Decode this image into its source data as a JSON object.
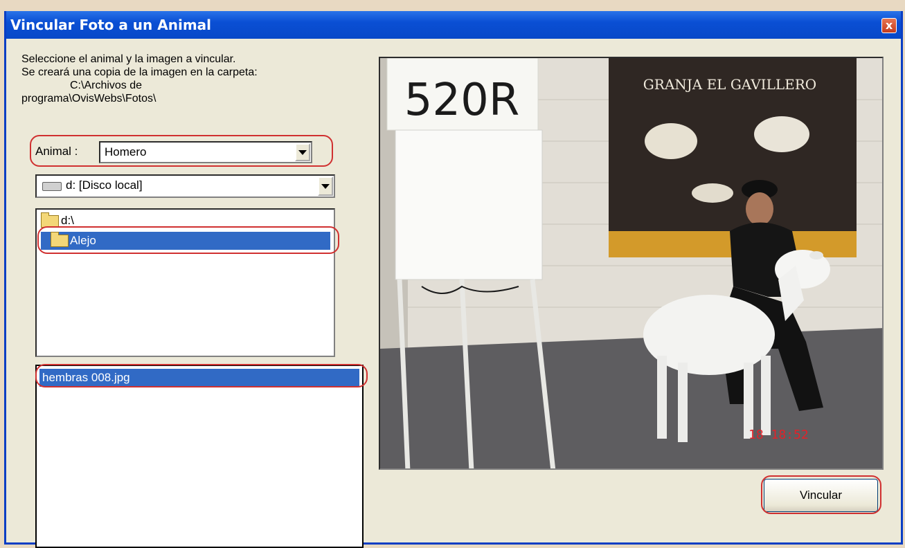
{
  "window": {
    "title": "Vincular Foto a un Animal",
    "close_label": "x"
  },
  "instructions": {
    "line1": "Seleccione el animal y la imagen a vincular.",
    "line2": "Se creará una copia de la imagen en la carpeta:",
    "line3": "C:\\Archivos de",
    "line4": "programa\\OvisWebs\\Fotos\\"
  },
  "animal": {
    "label": "Animal :",
    "value": "Homero"
  },
  "drive": {
    "value": "d: [Disco local]"
  },
  "folders": [
    {
      "label": "d:\\",
      "selected": false
    },
    {
      "label": "Alejo",
      "selected": true
    }
  ],
  "files": [
    {
      "label": "hembras 008.jpg",
      "selected": true
    }
  ],
  "photo": {
    "sign_text": "520R",
    "banner_text": "GRANJA EL GAVILLERO",
    "timestamp": "18 18:52"
  },
  "actions": {
    "vincular_label": "Vincular"
  },
  "colors": {
    "titlebar": "#0a4fd4",
    "selection": "#316ac5",
    "highlight_outline": "#d03030"
  }
}
